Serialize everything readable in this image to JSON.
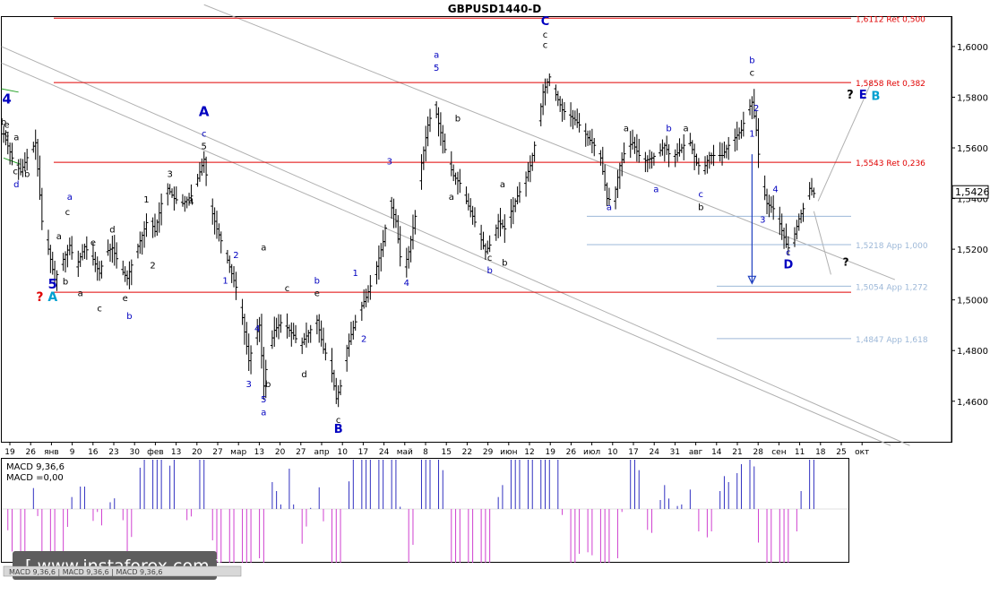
{
  "chart_data": {
    "type": "ohlc",
    "title": "GBPUSD1440-D",
    "y_range": [
      1.444,
      1.612
    ],
    "y_ticks": [
      "1,6000",
      "1,5800",
      "1,5600",
      "1,5400",
      "1,5200",
      "1,5000",
      "1,4800",
      "1,4600"
    ],
    "y_tick_values": [
      1.6,
      1.58,
      1.56,
      1.54,
      1.52,
      1.5,
      1.48,
      1.46
    ],
    "x_ticks": [
      "19",
      "26",
      "янв",
      "9",
      "16",
      "23",
      "30",
      "фев",
      "13",
      "20",
      "27",
      "мар",
      "13",
      "20",
      "27",
      "апр",
      "10",
      "17",
      "24",
      "май",
      "8",
      "15",
      "22",
      "29",
      "июн",
      "12",
      "19",
      "26",
      "июл",
      "10",
      "17",
      "24",
      "31",
      "авг",
      "14",
      "21",
      "28",
      "сен",
      "11",
      "18",
      "25",
      "окт"
    ],
    "current_price_label": "1,5426",
    "current_price": 1.5426,
    "levels": [
      {
        "label": "1,6112 Ret 0,500",
        "value": 1.6112,
        "color": "#e00000"
      },
      {
        "label": "1,5858 Ret 0,382",
        "value": 1.5858,
        "color": "#e00000"
      },
      {
        "label": "1,5543 Ret 0,236",
        "value": 1.5543,
        "color": "#e00000"
      },
      {
        "label": "1,5218 App 1,000",
        "value": 1.5218,
        "color": "#9db8d8"
      },
      {
        "label": "1,5054 App 1,272",
        "value": 1.5054,
        "color": "#9db8d8"
      },
      {
        "label": "1,4847 App 1,618",
        "value": 1.4847,
        "color": "#9db8d8"
      }
    ],
    "support_level": 1.503,
    "wave_labels": [
      {
        "t": "4",
        "i": 1.5,
        "p": 1.5775,
        "c": "#0000c0",
        "b": true,
        "s": 15
      },
      {
        "t": "b",
        "i": 0,
        "p": 1.569,
        "c": "#000000"
      },
      {
        "t": "e",
        "i": 1.5,
        "p": 1.568,
        "c": "#000000"
      },
      {
        "t": "c",
        "i": 1.5,
        "p": 1.5645,
        "c": "#000000"
      },
      {
        "t": "a",
        "i": 6,
        "p": 1.563,
        "c": "#000000"
      },
      {
        "t": "c",
        "i": 5.5,
        "p": 1.5495,
        "c": "#000000"
      },
      {
        "t": "b",
        "i": 11,
        "p": 1.5485,
        "c": "#000000"
      },
      {
        "t": "d",
        "i": 6,
        "p": 1.5445,
        "c": "#0000c0"
      },
      {
        "t": "a",
        "i": 31,
        "p": 1.5395,
        "c": "#0000c0"
      },
      {
        "t": "c",
        "i": 30,
        "p": 1.5335,
        "c": "#000000"
      },
      {
        "t": "a",
        "i": 26,
        "p": 1.524,
        "c": "#000000"
      },
      {
        "t": "e",
        "i": 42,
        "p": 1.5215,
        "c": "#000000"
      },
      {
        "t": "d",
        "i": 51,
        "p": 1.5265,
        "c": "#000000"
      },
      {
        "t": "b",
        "i": 29,
        "p": 1.506,
        "c": "#000000"
      },
      {
        "t": "a",
        "i": 36,
        "p": 1.5015,
        "c": "#000000"
      },
      {
        "t": "c",
        "i": 45,
        "p": 1.4955,
        "c": "#000000"
      },
      {
        "t": "e",
        "i": 57,
        "p": 1.4995,
        "c": "#000000"
      },
      {
        "t": "b",
        "i": 59,
        "p": 1.4925,
        "c": "#0000c0"
      },
      {
        "t": "5",
        "i": 23,
        "p": 1.5045,
        "c": "#0000c0",
        "b": true,
        "s": 15
      },
      {
        "t": "?",
        "i": 17,
        "p": 1.4995,
        "c": "#e00000",
        "b": true,
        "s": 14
      },
      {
        "t": "A",
        "i": 23,
        "p": 1.4995,
        "c": "#00a0d0",
        "b": true,
        "s": 14
      },
      {
        "t": "1",
        "i": 67,
        "p": 1.5385,
        "c": "#000000"
      },
      {
        "t": "2",
        "i": 70,
        "p": 1.5125,
        "c": "#000000"
      },
      {
        "t": "3",
        "i": 78,
        "p": 1.5485,
        "c": "#000000"
      },
      {
        "t": "4",
        "i": 88,
        "p": 1.5375,
        "c": "#000000"
      },
      {
        "t": "5",
        "i": 94,
        "p": 1.5595,
        "c": "#000000"
      },
      {
        "t": "A",
        "i": 94,
        "p": 1.5725,
        "c": "#0000c0",
        "b": true,
        "s": 15
      },
      {
        "t": "c",
        "i": 94,
        "p": 1.5645,
        "c": "#0000c0"
      },
      {
        "t": "1",
        "i": 104,
        "p": 1.5065,
        "c": "#0000c0"
      },
      {
        "t": "2",
        "i": 109,
        "p": 1.5165,
        "c": "#0000c0"
      },
      {
        "t": "a",
        "i": 122,
        "p": 1.5195,
        "c": "#000000"
      },
      {
        "t": "4",
        "i": 119,
        "p": 1.4875,
        "c": "#0000c0"
      },
      {
        "t": "3",
        "i": 115,
        "p": 1.4655,
        "c": "#0000c0"
      },
      {
        "t": "b",
        "i": 124,
        "p": 1.4655,
        "c": "#000000"
      },
      {
        "t": "5",
        "i": 122,
        "p": 1.4595,
        "c": "#0000c0"
      },
      {
        "t": "a",
        "i": 122,
        "p": 1.4545,
        "c": "#0000c0"
      },
      {
        "t": "c",
        "i": 133,
        "p": 1.5035,
        "c": "#000000"
      },
      {
        "t": "d",
        "i": 141,
        "p": 1.4695,
        "c": "#000000"
      },
      {
        "t": "b",
        "i": 147,
        "p": 1.5065,
        "c": "#0000c0"
      },
      {
        "t": "e",
        "i": 147,
        "p": 1.5015,
        "c": "#000000"
      },
      {
        "t": "c",
        "i": 157,
        "p": 1.4515,
        "c": "#000000"
      },
      {
        "t": "B",
        "i": 157,
        "p": 1.4475,
        "c": "#0000c0",
        "b": true,
        "s": 13
      },
      {
        "t": "1",
        "i": 165,
        "p": 1.5095,
        "c": "#0000c0"
      },
      {
        "t": "2",
        "i": 169,
        "p": 1.4835,
        "c": "#0000c0"
      },
      {
        "t": "3",
        "i": 181,
        "p": 1.5535,
        "c": "#0000c0"
      },
      {
        "t": "4",
        "i": 189,
        "p": 1.5055,
        "c": "#0000c0"
      },
      {
        "t": "a",
        "i": 203,
        "p": 1.5955,
        "c": "#0000c0"
      },
      {
        "t": "5",
        "i": 203,
        "p": 1.5905,
        "c": "#0000c0"
      },
      {
        "t": "b",
        "i": 213,
        "p": 1.5705,
        "c": "#000000"
      },
      {
        "t": "a",
        "i": 210,
        "p": 1.5395,
        "c": "#000000"
      },
      {
        "t": "a",
        "i": 234,
        "p": 1.5445,
        "c": "#000000"
      },
      {
        "t": "c",
        "i": 228,
        "p": 1.5155,
        "c": "#000000"
      },
      {
        "t": "b",
        "i": 228,
        "p": 1.5105,
        "c": "#0000c0"
      },
      {
        "t": "b",
        "i": 235,
        "p": 1.5135,
        "c": "#000000"
      },
      {
        "t": "C",
        "i": 254,
        "p": 1.6085,
        "c": "#0000c0",
        "b": true,
        "s": 13
      },
      {
        "t": "c",
        "i": 254,
        "p": 1.6035,
        "c": "#000000"
      },
      {
        "t": "c",
        "i": 254,
        "p": 1.5995,
        "c": "#000000"
      },
      {
        "t": "a",
        "i": 284,
        "p": 1.5355,
        "c": "#0000c0"
      },
      {
        "t": "a",
        "i": 292,
        "p": 1.5665,
        "c": "#000000"
      },
      {
        "t": "a",
        "i": 306,
        "p": 1.5425,
        "c": "#0000c0"
      },
      {
        "t": "b",
        "i": 312,
        "p": 1.5665,
        "c": "#0000c0"
      },
      {
        "t": "a",
        "i": 320,
        "p": 1.5665,
        "c": "#000000"
      },
      {
        "t": "c",
        "i": 327,
        "p": 1.5405,
        "c": "#0000c0"
      },
      {
        "t": "b",
        "i": 327,
        "p": 1.5355,
        "c": "#000000"
      },
      {
        "t": "b",
        "i": 351,
        "p": 1.5935,
        "c": "#0000c0"
      },
      {
        "t": "c",
        "i": 351,
        "p": 1.5885,
        "c": "#000000"
      },
      {
        "t": "2",
        "i": 353,
        "p": 1.5745,
        "c": "#0000c0"
      },
      {
        "t": "1",
        "i": 351,
        "p": 1.5645,
        "c": "#0000c0"
      },
      {
        "t": "4",
        "i": 362,
        "p": 1.5425,
        "c": "#0000c0"
      },
      {
        "t": "3",
        "i": 356,
        "p": 1.5305,
        "c": "#0000c0"
      },
      {
        "t": "c",
        "i": 368,
        "p": 1.5175,
        "c": "#0000c0"
      },
      {
        "t": "D",
        "i": 368,
        "p": 1.5125,
        "c": "#0000c0",
        "b": true,
        "s": 13
      },
      {
        "t": "?",
        "i": 397,
        "p": 1.5795,
        "c": "#000000",
        "b": true,
        "s": 13
      },
      {
        "t": "E",
        "i": 403,
        "p": 1.5795,
        "c": "#0000c0",
        "b": true,
        "s": 13
      },
      {
        "t": "B",
        "i": 409,
        "p": 1.579,
        "c": "#00a0d0",
        "b": true,
        "s": 13
      },
      {
        "t": "?",
        "i": 395,
        "p": 1.5135,
        "c": "#000000",
        "b": true,
        "s": 12
      }
    ],
    "trend_lines": [
      {
        "i1": -1,
        "p1": 1.6,
        "i2": 425,
        "p2": 1.4425,
        "color": "#b0b0b0"
      },
      {
        "i1": -1,
        "p1": 1.5935,
        "i2": 416,
        "p2": 1.4425,
        "color": "#b0b0b0"
      },
      {
        "i1": 94,
        "p1": 1.6165,
        "i2": 418,
        "p2": 1.508,
        "color": "#b0b0b0"
      },
      {
        "i1": -1,
        "p1": 1.5833,
        "i2": 7,
        "p2": 1.582,
        "color": "#22a022"
      },
      {
        "i1": 0,
        "p1": 1.556,
        "i2": 8,
        "p2": 1.5535,
        "color": "#22a022"
      },
      {
        "i1": 382,
        "p1": 1.539,
        "i2": 407,
        "p2": 1.586,
        "color": "#b0b0b0"
      },
      {
        "i1": 380,
        "p1": 1.535,
        "i2": 388,
        "p2": 1.51,
        "color": "#b0b0b0"
      }
    ],
    "arrow": {
      "i": 351,
      "p_from": 1.5575,
      "p_to": 1.5065,
      "color": "#2040c0"
    },
    "macd": {
      "label": "MACD 9,36,6",
      "value_label": "MACD =0,00",
      "pos_color": "#3030c0",
      "neg_color": "#d040d0"
    },
    "watermark": "[ www.instaforex.com ]",
    "bottom_tab": "MACD 9,36,6 | MACD 9,36,6 | MACD 9,36,6"
  }
}
